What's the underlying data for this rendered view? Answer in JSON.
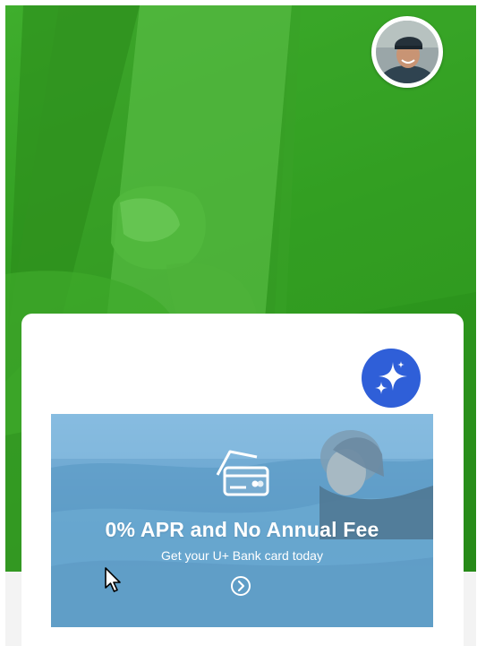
{
  "header": {
    "avatar_alt": "Profile photo",
    "avatar_icon": "avatar"
  },
  "assistant": {
    "icon": "sparkle-icon"
  },
  "promo": {
    "icon": "credit-card-icon",
    "title": "0% APR and No Annual Fee",
    "subtitle": "Get your U+ Bank card today",
    "action_icon": "chevron-right-circle-icon"
  },
  "colors": {
    "hero_green": "#2f9a1f",
    "assistant_blue": "#2f5fd8",
    "banner_blue": "#6ba6d0",
    "footer_gray": "#f3f3f3"
  }
}
